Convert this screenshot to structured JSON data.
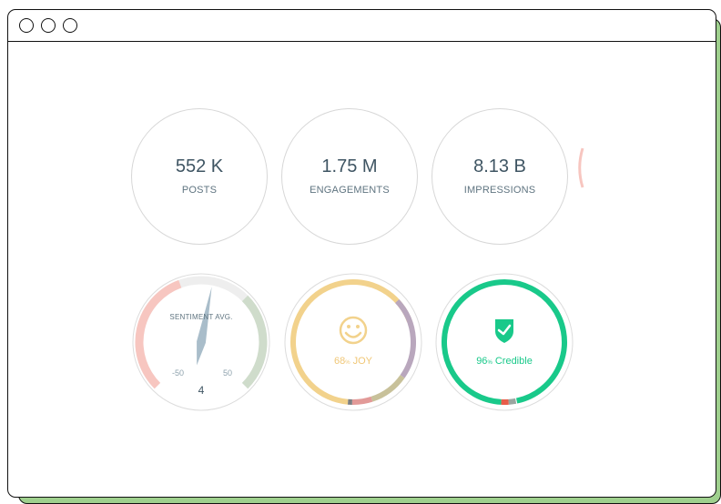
{
  "stats": [
    {
      "value": "552 K",
      "label": "POSTS"
    },
    {
      "value": "1.75 M",
      "label": "ENGAGEMENTS"
    },
    {
      "value": "8.13 B",
      "label": "IMPRESSIONS"
    }
  ],
  "sentiment": {
    "title": "SENTIMENT AVG.",
    "min_label": "-50",
    "max_label": "50",
    "value": "4",
    "value_numeric": 4
  },
  "emotion": {
    "percent": "68",
    "percent_sign": "%",
    "label": "JOY",
    "icon": "smiley-face-icon",
    "fraction": 0.68
  },
  "credibility": {
    "percent": "96",
    "percent_sign": "%",
    "label": "Credible",
    "icon": "shield-check-icon",
    "fraction": 0.96
  },
  "colors": {
    "dark_text": "#3f5563",
    "joy": "#f2d28c",
    "credible": "#19c98a",
    "negative": "#f7c6c0",
    "positive": "#cfdccb",
    "needle": "#a9bdca"
  }
}
